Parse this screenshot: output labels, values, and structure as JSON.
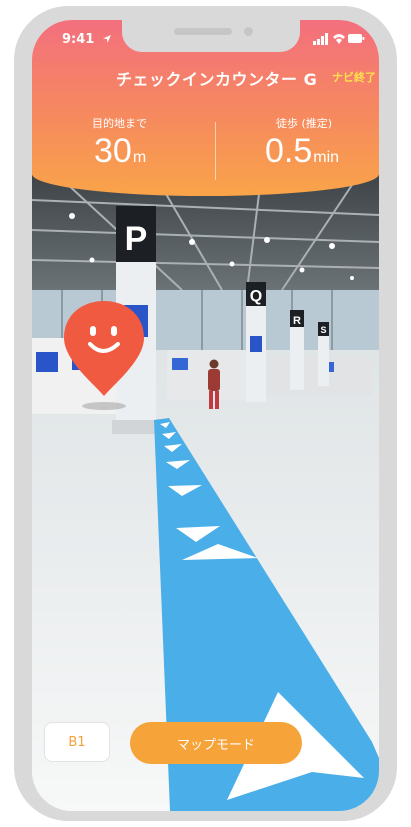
{
  "status_bar": {
    "time": "9:41",
    "location_arrow": "location-arrow-icon"
  },
  "header": {
    "destination": "チェックインカウンター G",
    "end_nav_label": "ナビ終了",
    "distance_label": "目的地まで",
    "distance_value": "30",
    "distance_unit": "m",
    "time_label": "徒歩 (推定)",
    "time_value": "0.5",
    "time_unit": "min"
  },
  "scene": {
    "signs": [
      "P",
      "Q",
      "R",
      "S"
    ]
  },
  "controls": {
    "floor_label": "B1",
    "map_mode_label": "マップモード"
  },
  "colors": {
    "accent_orange": "#f6a33a",
    "route_blue": "#4aaee8",
    "pin_red": "#f05a40",
    "header_top": "#f36f7e",
    "header_bottom": "#f9a449"
  }
}
